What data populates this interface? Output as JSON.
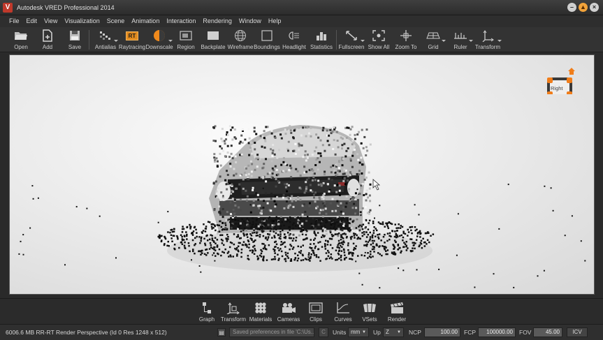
{
  "window": {
    "title": "Autodesk VRED Professional 2014",
    "logo_letter": "V",
    "controls": [
      "minimize-icon",
      "maximize-icon",
      "close-icon"
    ]
  },
  "menu": [
    "File",
    "Edit",
    "View",
    "Visualization",
    "Scene",
    "Animation",
    "Interaction",
    "Rendering",
    "Window",
    "Help"
  ],
  "toolbar": {
    "open": "Open",
    "add": "Add",
    "save": "Save",
    "antialias": "Antialias",
    "raytracing": "Raytracing",
    "raytracing_badge": "RT",
    "downscale": "Downscale",
    "region": "Region",
    "backplate": "Backplate",
    "wireframe": "Wireframe",
    "boundings": "Boundings",
    "headlight": "Headlight",
    "statistics": "Statistics",
    "fullscreen": "Fullscreen",
    "show_all": "Show All",
    "zoom_to": "Zoom To",
    "grid": "Grid",
    "ruler": "Ruler",
    "transform": "Transform"
  },
  "viewport": {
    "navcube_face": "Right",
    "accent_color": "#f07d1a"
  },
  "modules": [
    "Graph",
    "Transform",
    "Materials",
    "Cameras",
    "Clips",
    "Curves",
    "VSets",
    "Render"
  ],
  "status": {
    "info": "6006.6 MB  RR-RT  Render Perspective (Id 0 Res 1248 x 512)",
    "message": "Saved preferences in file 'C:\\Us...",
    "c_label": "C",
    "units_label": "Units",
    "units_value": "mm",
    "up_label": "Up",
    "up_value": "Z",
    "ncp_label": "NCP",
    "ncp_value": "100.00",
    "fcp_label": "FCP",
    "fcp_value": "100000.00",
    "fov_label": "FOV",
    "fov_value": "45.00",
    "icv_label": "ICV"
  }
}
